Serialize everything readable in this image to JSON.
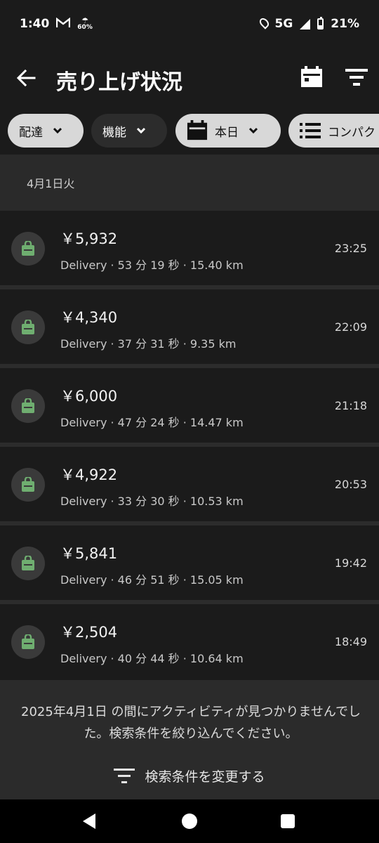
{
  "status_bar": {
    "time": "1:40",
    "mail_icon": "gmail-icon",
    "weather_percent": "60%",
    "network": "5G",
    "battery": "21%"
  },
  "app_bar": {
    "title": "売り上げ状況",
    "icons": [
      "back-arrow-icon",
      "calendar-icon",
      "filter-icon"
    ]
  },
  "chips": [
    {
      "label": "配達"
    },
    {
      "label": "機能"
    },
    {
      "label": "本日"
    },
    {
      "label": "コンパクト"
    }
  ],
  "date_header": "4月1日火",
  "trips": [
    {
      "amount": "￥5,932",
      "detail": "Delivery · 53 分 19 秒 · 15.40 km",
      "time": "23:25"
    },
    {
      "amount": "￥4,340",
      "detail": "Delivery · 37 分 31 秒 · 9.35 km",
      "time": "22:09"
    },
    {
      "amount": "￥6,000",
      "detail": "Delivery · 47 分 24 秒 · 14.47 km",
      "time": "21:18"
    },
    {
      "amount": "￥4,922",
      "detail": "Delivery · 33 分 30 秒 · 10.53 km",
      "time": "20:53"
    },
    {
      "amount": "￥5,841",
      "detail": "Delivery · 46 分 51 秒 · 15.05 km",
      "time": "19:42"
    },
    {
      "amount": "￥2,504",
      "detail": "Delivery · 40 分 44 秒 · 10.64 km",
      "time": "18:49"
    }
  ],
  "footer": {
    "message": "2025年4月1日 の間にアクティビティが見つかりませんでした。検索条件を絞り込んでください。",
    "button_label": "検索条件を変更する"
  },
  "colors": {
    "background": "#1b1b1b",
    "chip_light": "#d8d8d8",
    "chip_dark": "#2c2c2c",
    "bag_green": "#6fae70"
  }
}
